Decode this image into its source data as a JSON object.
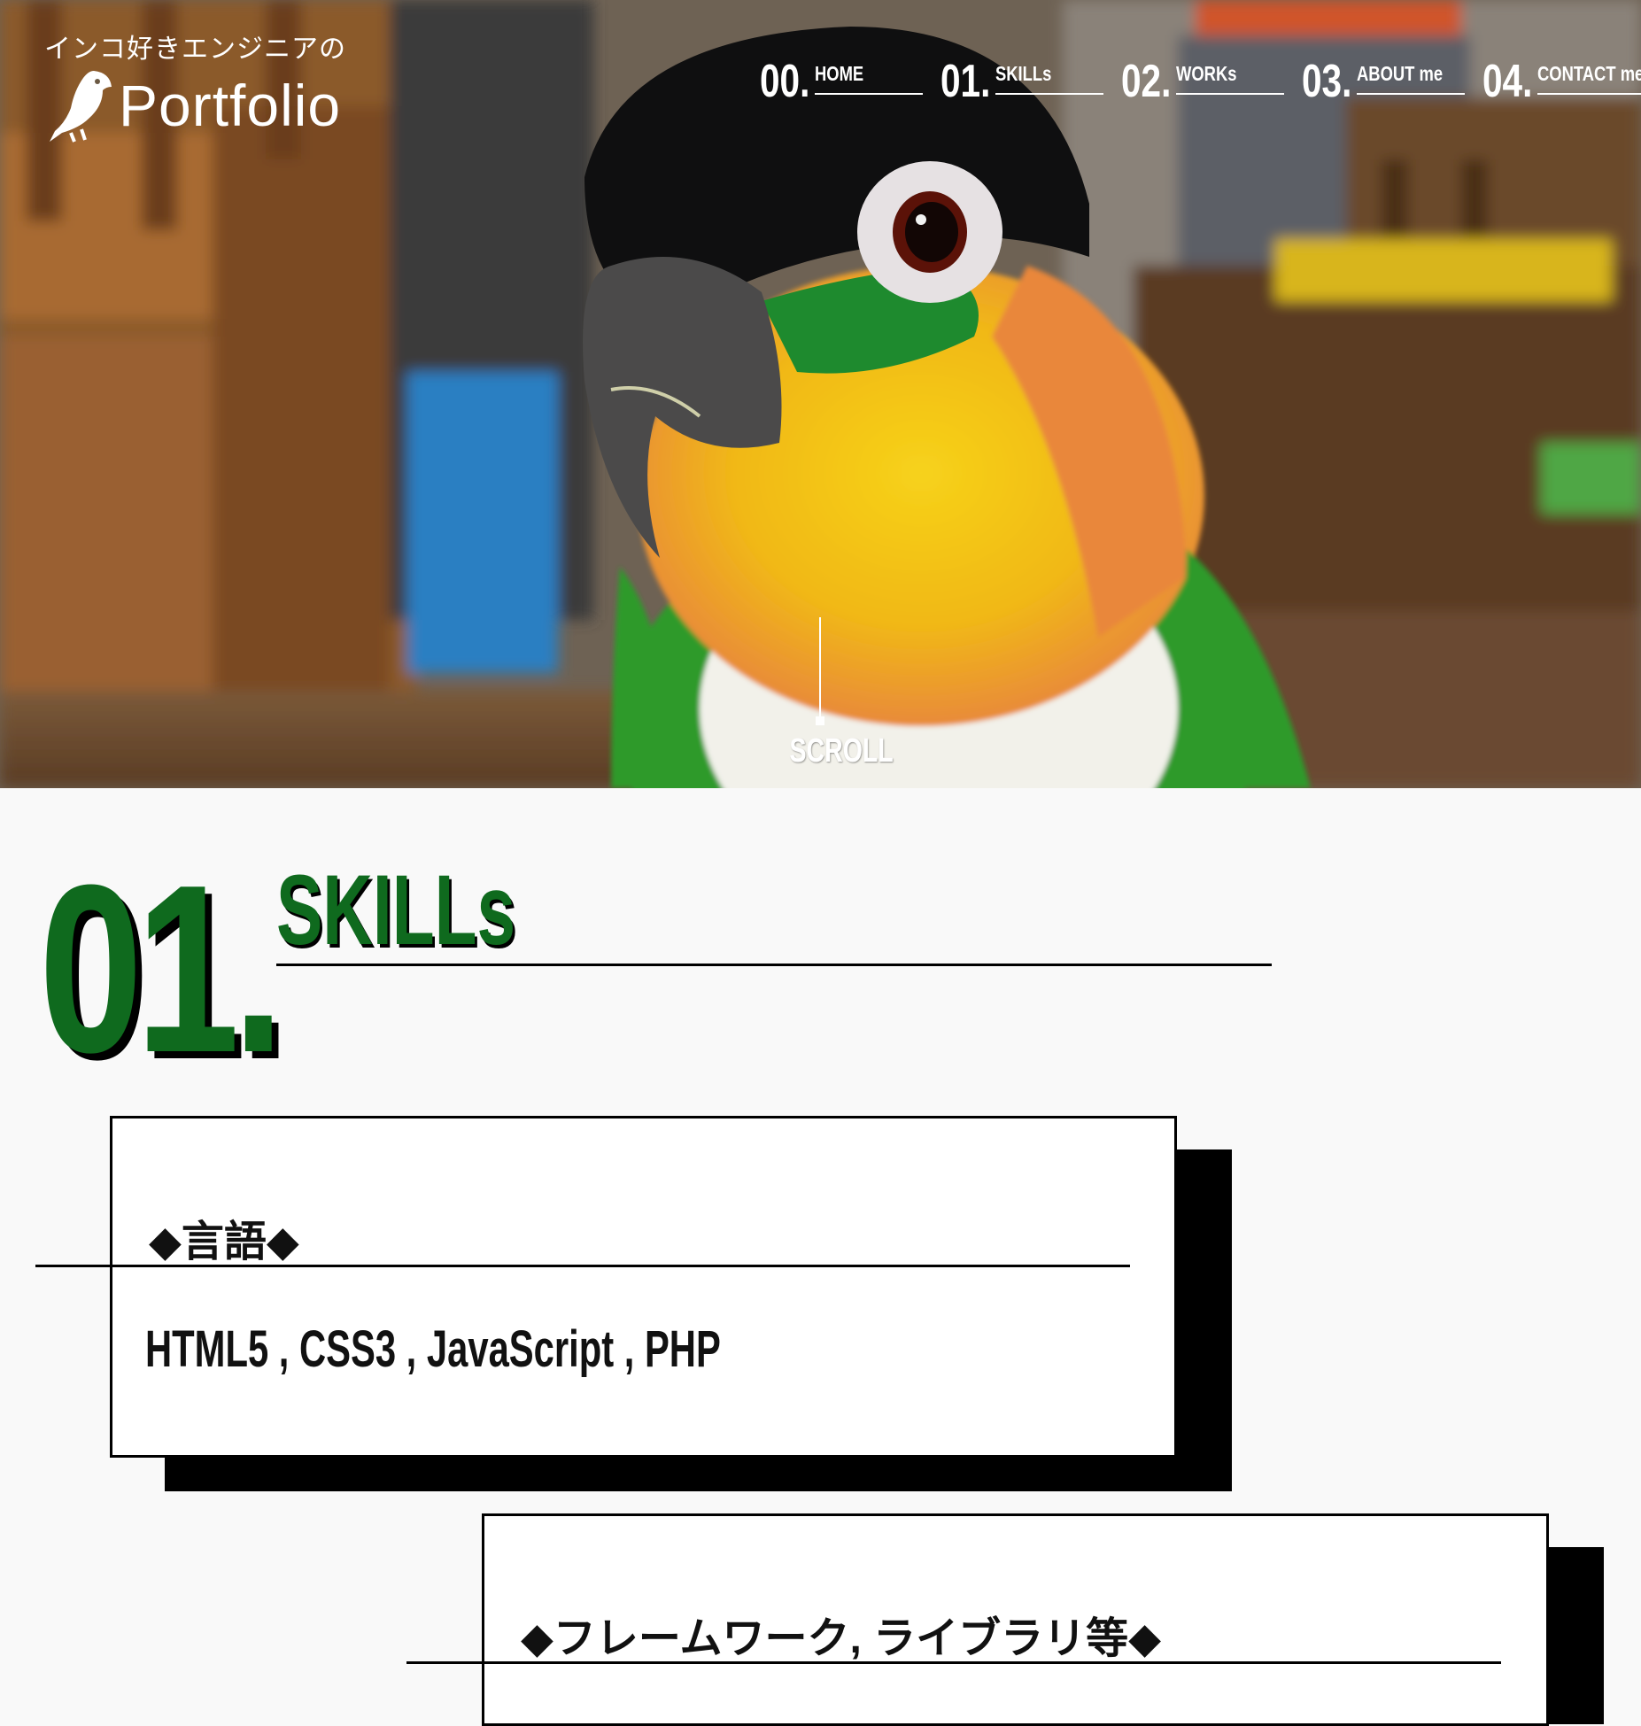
{
  "brand": {
    "tagline": "インコ好きエンジニアの",
    "name": "Portfolio"
  },
  "nav": [
    {
      "num": "00.",
      "label": "HOME"
    },
    {
      "num": "01.",
      "label": "SKILLs"
    },
    {
      "num": "02.",
      "label": "WORKs"
    },
    {
      "num": "03.",
      "label": "ABOUT me"
    },
    {
      "num": "04.",
      "label": "CONTACT me"
    }
  ],
  "hero": {
    "scroll_label": "SCROLL"
  },
  "section": {
    "num": "01.",
    "title": "SKILLs"
  },
  "cards": [
    {
      "heading": "◆言語◆",
      "body": "HTML5 , CSS3 , JavaScript , PHP"
    },
    {
      "heading": "◆フレームワーク, ライブラリ等◆",
      "body": ""
    }
  ],
  "colors": {
    "accent_green": "#0f6a1e",
    "shadow": "#000000",
    "page_bg": "#f9f9f9"
  }
}
